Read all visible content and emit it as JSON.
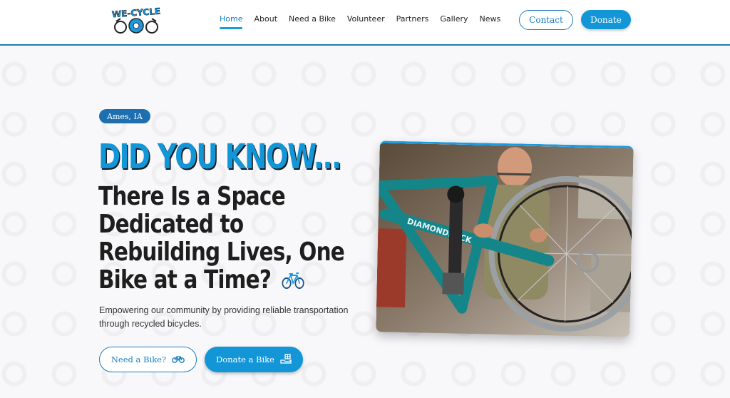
{
  "header": {
    "logo_text": "WE-CYCLE",
    "nav": [
      {
        "label": "Home",
        "active": true
      },
      {
        "label": "About",
        "active": false
      },
      {
        "label": "Need a Bike",
        "active": false
      },
      {
        "label": "Volunteer",
        "active": false
      },
      {
        "label": "Partners",
        "active": false
      },
      {
        "label": "Gallery",
        "active": false
      },
      {
        "label": "News",
        "active": false
      }
    ],
    "contact_label": "Contact",
    "donate_label": "Donate"
  },
  "hero": {
    "location": "Ames, IA",
    "headline_blue": "DID YOU KNOW...",
    "headline_dark": "There Is a Space Dedicated to Rebuilding Lives, One Bike at a Time?",
    "subtext": "Empowering our community by providing reliable transportation through recycled bicycles.",
    "need_bike_label": "Need a Bike?",
    "donate_bike_label": "Donate a Bike",
    "photo_bike_brand": "DIAMONDBACK"
  },
  "colors": {
    "accent": "#1296d8",
    "badge": "#1e6fb0",
    "headline_dark": "#1e1e1e",
    "header_border": "#1f7bb8"
  },
  "icons": {
    "need_bike": "bicycle-icon",
    "donate_bike": "hand-gift-icon",
    "headline_emoji": "bicycle-icon"
  }
}
